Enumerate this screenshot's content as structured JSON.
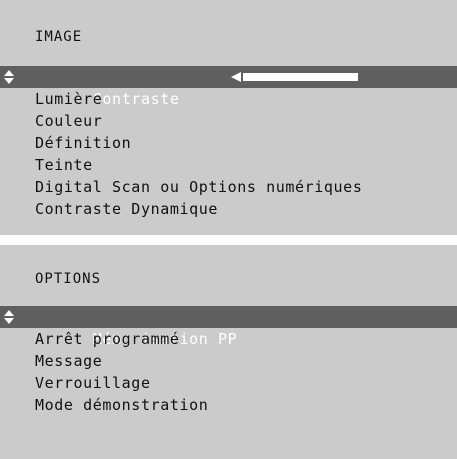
{
  "colors": {
    "panel_bg": "#cbcbcb",
    "selected_bg": "#5f5f5f",
    "text": "#111111",
    "selected_text": "#ffffff"
  },
  "image_menu": {
    "title": "IMAGE",
    "items": [
      {
        "label": "Contraste"
      },
      {
        "label": "Lumière"
      },
      {
        "label": "Couleur"
      },
      {
        "label": "Définition"
      },
      {
        "label": "Teinte"
      },
      {
        "label": "Digital Scan ou Options numériques"
      },
      {
        "label": "Contraste Dynamique"
      }
    ],
    "selected_index": 0,
    "contrast_level": 1.0
  },
  "options_menu": {
    "title": "OPTIONS",
    "items": [
      {
        "label": "Mémorisation PP"
      },
      {
        "label": "Arrêt programmé"
      },
      {
        "label": "Message"
      },
      {
        "label": "Verrouillage"
      },
      {
        "label": "Mode démonstration"
      }
    ],
    "selected_index": 0
  },
  "icons": {
    "selector": "up-down-arrow-icon",
    "slider_left": "left-triangle-icon"
  }
}
